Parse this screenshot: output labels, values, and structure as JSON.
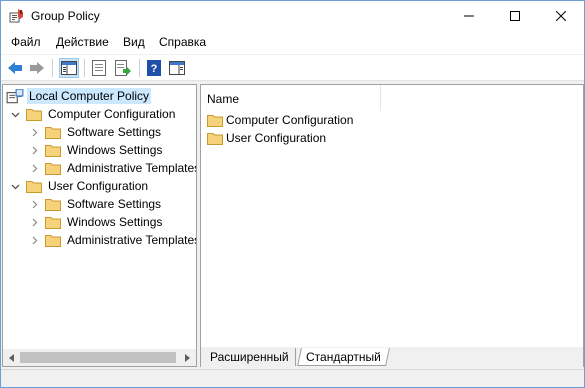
{
  "window": {
    "title": "Group Policy"
  },
  "menu": {
    "items": [
      "Файл",
      "Действие",
      "Вид",
      "Справка"
    ]
  },
  "toolbar": {
    "buttons": [
      "back-icon",
      "forward-icon",
      "show-hide-console-tree-icon",
      "properties-icon",
      "export-list-icon",
      "help-icon",
      "show-action-pane-icon"
    ]
  },
  "tree": {
    "root": "Local Computer Policy",
    "computer": {
      "label": "Computer Configuration",
      "children": [
        "Software Settings",
        "Windows Settings",
        "Administrative Templates"
      ]
    },
    "user": {
      "label": "User Configuration",
      "children": [
        "Software Settings",
        "Windows Settings",
        "Administrative Templates"
      ]
    }
  },
  "details": {
    "column": "Name",
    "items": [
      "Computer Configuration",
      "User Configuration"
    ]
  },
  "tabs": {
    "extended": "Расширенный",
    "standard": "Стандартный"
  },
  "colors": {
    "folder": "#f6d27a",
    "folder_dark": "#e0b24a",
    "selection": "#cce8ff",
    "accent": "#6b9fd6"
  }
}
